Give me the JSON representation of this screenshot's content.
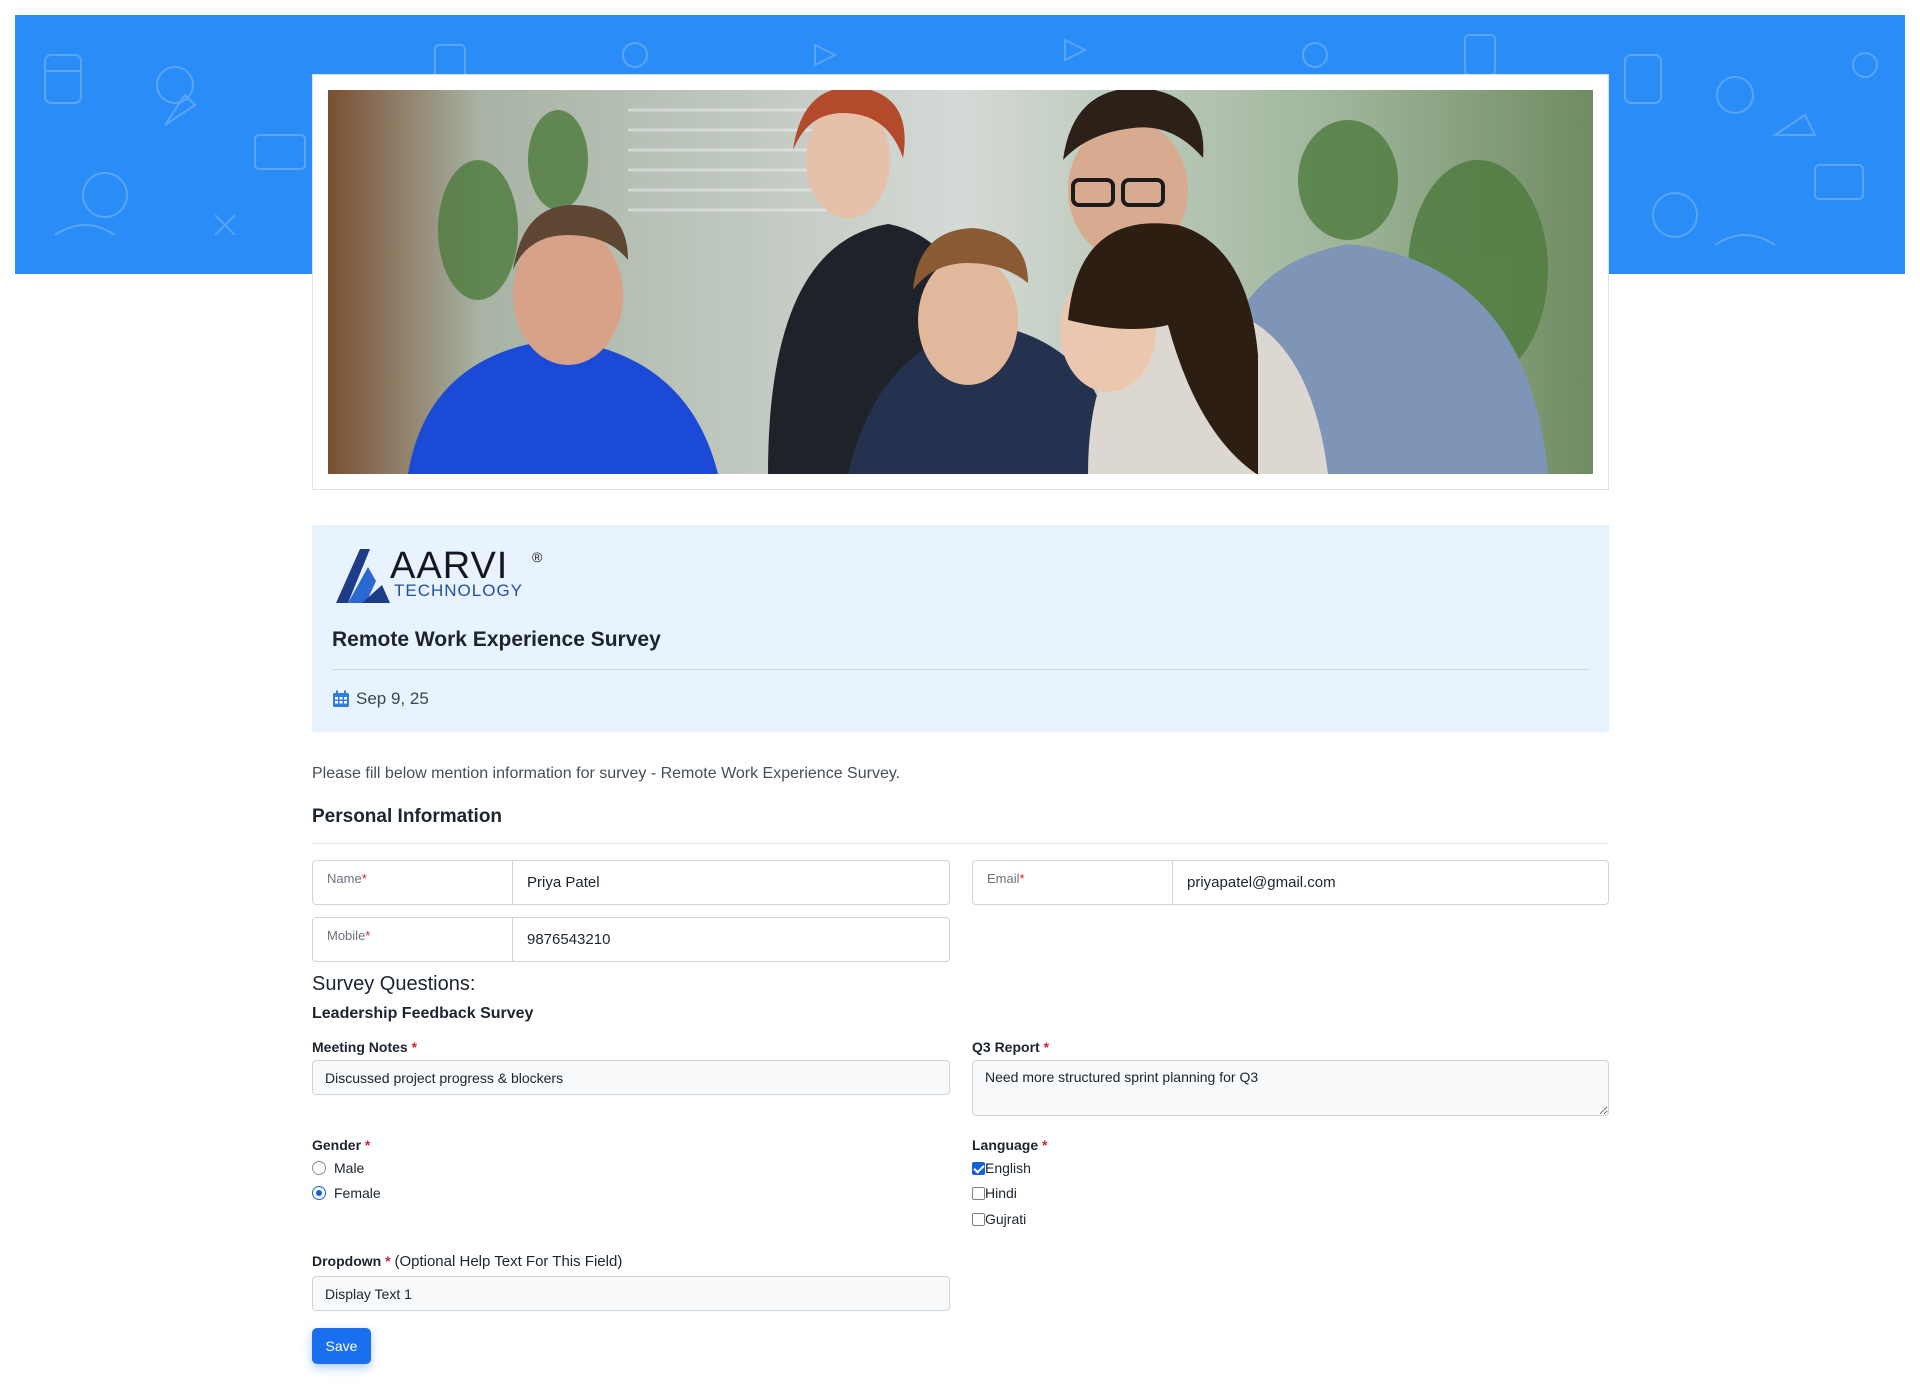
{
  "colors": {
    "banner": "#2a8cf6",
    "info_card": "#e8f3fe",
    "primary": "#1a6ef0",
    "required": "#d0252f"
  },
  "brand": {
    "name": "AARVI",
    "registered": "®",
    "subtitle": "TECHNOLOGY"
  },
  "survey": {
    "title": "Remote Work Experience Survey",
    "date": "Sep 9, 25",
    "date_icon": "calendar-icon",
    "intro": "Please fill below mention information for survey - Remote Work Experience Survey."
  },
  "personal": {
    "title": "Personal Information",
    "name_label": "Name",
    "name_value": "Priya Patel",
    "email_label": "Email",
    "email_value": "priyapatel@gmail.com",
    "mobile_label": "Mobile",
    "mobile_value": "9876543210",
    "required_mark": "*"
  },
  "questions": {
    "title": "Survey Questions:",
    "subtitle": "Leadership Feedback Survey",
    "meeting_notes_label": "Meeting Notes",
    "meeting_notes_value": "Discussed project progress & blockers",
    "q3_label": "Q3 Report",
    "q3_value": "Need more structured sprint planning for Q3",
    "gender_label": "Gender",
    "gender_options": [
      "Male",
      "Female"
    ],
    "gender_selected": "Female",
    "language_label": "Language",
    "language_options": [
      "English",
      "Hindi",
      "Gujrati"
    ],
    "language_checked": [
      "English"
    ],
    "dropdown_label": "Dropdown",
    "dropdown_help": "(Optional Help Text For This Field)",
    "dropdown_value": "Display Text 1",
    "required_mark": "*"
  },
  "actions": {
    "save_label": "Save"
  }
}
